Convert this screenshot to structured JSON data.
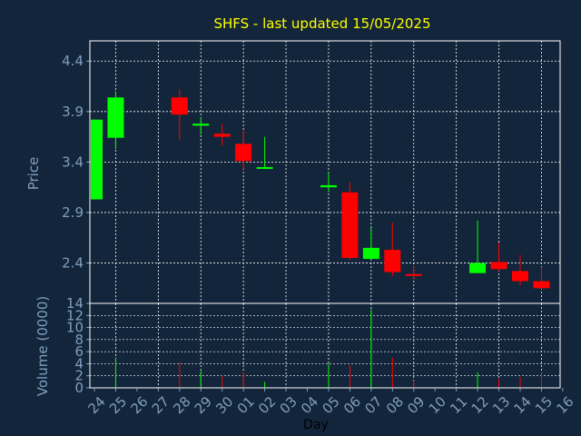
{
  "colors": {
    "background": "#13253a",
    "plot_border": "#ffffff",
    "grid": "#ffffff",
    "title": "#ffff00",
    "axis_text": "#7f9fbf",
    "up": "#00ff00",
    "down": "#ff0000"
  },
  "chart_data": {
    "type": "candlestick",
    "title": "SHFS - last updated 15/05/2025",
    "xlabel": "Day",
    "price_panel": {
      "ylabel": "Price",
      "yticks": [
        "2.4",
        "2.9",
        "3.4",
        "3.9",
        "4.4"
      ],
      "ylim": [
        2.0,
        4.6
      ],
      "grid": true
    },
    "volume_panel": {
      "ylabel": "Volume (0000)",
      "yticks": [
        "0",
        "2",
        "4",
        "6",
        "8",
        "10",
        "12",
        "14"
      ],
      "ylim": [
        0,
        14
      ],
      "grid": true
    },
    "x_ticks": [
      "24",
      "25",
      "26",
      "27",
      "28",
      "29",
      "30",
      "01",
      "02",
      "03",
      "04",
      "05",
      "06",
      "07",
      "08",
      "09",
      "10",
      "11",
      "12",
      "13",
      "14",
      "15",
      "16"
    ],
    "candles": [
      {
        "day": "24",
        "open": 3.03,
        "high": 3.82,
        "low": 3.03,
        "close": 3.82,
        "volume": 0
      },
      {
        "day": "25",
        "open": 3.64,
        "high": 4.1,
        "low": 3.53,
        "close": 4.04,
        "volume": 5
      },
      {
        "day": "28",
        "open": 4.04,
        "high": 4.12,
        "low": 3.62,
        "close": 3.87,
        "volume": 4.2
      },
      {
        "day": "29",
        "open": 3.76,
        "high": 3.84,
        "low": 3.67,
        "close": 3.78,
        "volume": 2.8
      },
      {
        "day": "30",
        "open": 3.68,
        "high": 3.78,
        "low": 3.56,
        "close": 3.65,
        "volume": 2
      },
      {
        "day": "01",
        "open": 3.58,
        "high": 3.71,
        "low": 3.33,
        "close": 3.41,
        "volume": 2.6
      },
      {
        "day": "02",
        "open": 3.34,
        "high": 3.65,
        "low": 3.33,
        "close": 3.35,
        "volume": 1
      },
      {
        "day": "05",
        "open": 3.15,
        "high": 3.3,
        "low": 3.1,
        "close": 3.17,
        "volume": 4
      },
      {
        "day": "06",
        "open": 3.1,
        "high": 3.2,
        "low": 2.43,
        "close": 2.45,
        "volume": 3.7
      },
      {
        "day": "07",
        "open": 2.44,
        "high": 2.75,
        "low": 2.43,
        "close": 2.55,
        "volume": 13
      },
      {
        "day": "08",
        "open": 2.53,
        "high": 2.8,
        "low": 2.27,
        "close": 2.31,
        "volume": 5
      },
      {
        "day": "09",
        "open": 2.29,
        "high": 2.37,
        "low": 2.23,
        "close": 2.28,
        "volume": 1.2
      },
      {
        "day": "12",
        "open": 2.3,
        "high": 2.82,
        "low": 2.3,
        "close": 2.4,
        "volume": 2.6
      },
      {
        "day": "13",
        "open": 2.41,
        "high": 2.6,
        "low": 2.32,
        "close": 2.34,
        "volume": 1.5
      },
      {
        "day": "14",
        "open": 2.32,
        "high": 2.48,
        "low": 2.18,
        "close": 2.22,
        "volume": 1.8
      },
      {
        "day": "15",
        "open": 2.22,
        "high": 2.36,
        "low": 2.14,
        "close": 2.15,
        "volume": 2.5
      }
    ]
  }
}
